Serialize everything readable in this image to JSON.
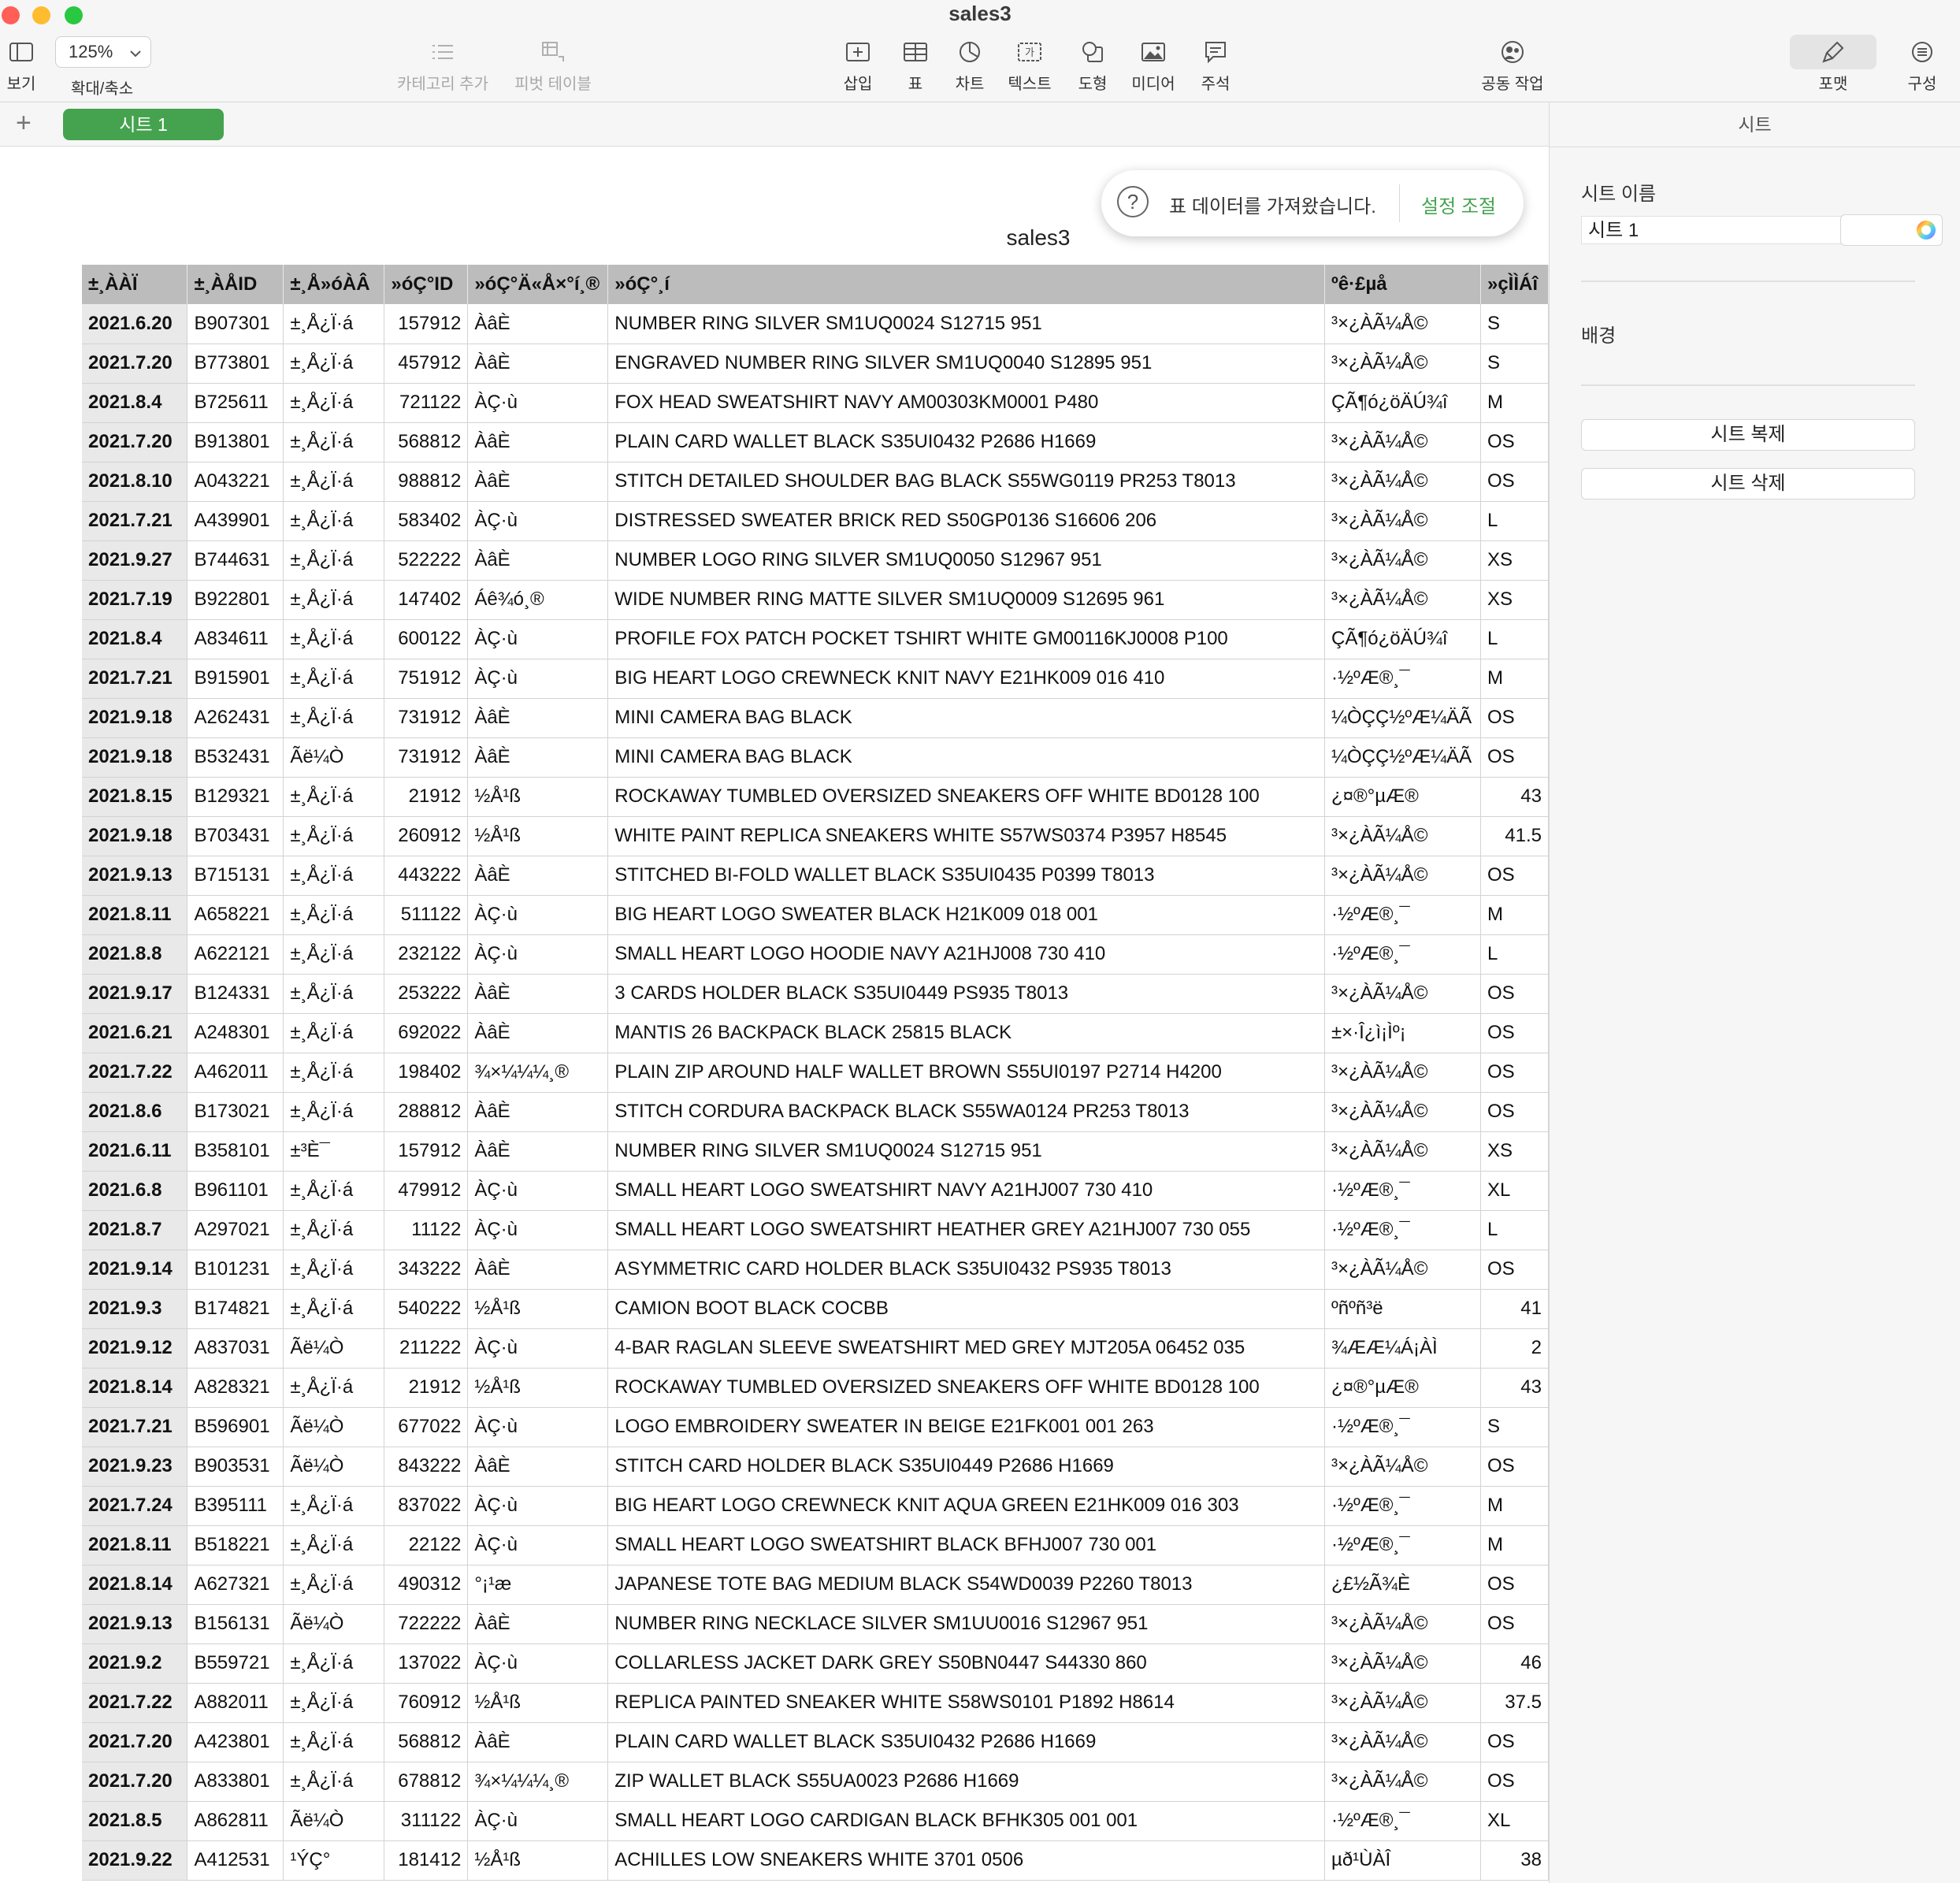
{
  "window": {
    "title": "sales3"
  },
  "toolbar": {
    "view_label": "보기",
    "zoom_value": "125%",
    "zoom_label": "확대/축소",
    "category_label": "카테고리 추가",
    "pivot_label": "피벗 테이블",
    "insert_label": "삽입",
    "table_label": "표",
    "chart_label": "차트",
    "text_label": "텍스트",
    "shape_label": "도형",
    "media_label": "미디어",
    "comment_label": "주석",
    "collab_label": "공동 작업",
    "format_label": "포맷",
    "organize_label": "구성"
  },
  "tabs": {
    "add": "+",
    "sheet_label": "시트 1"
  },
  "inspector": {
    "header": "시트",
    "sheet_name_label": "시트 이름",
    "sheet_name_value": "시트 1",
    "background_label": "배경",
    "duplicate_button": "시트 복제",
    "delete_button": "시트 삭제"
  },
  "notification": {
    "icon": "?",
    "message": "표 데이터를 가져왔습니다.",
    "action": "설정 조절"
  },
  "document": {
    "title": "sales3"
  },
  "table": {
    "headers": [
      "±¸ÀÀÏ",
      "±¸ÀÅID",
      "±¸Å»óÀÂ",
      "»óÇ°ID",
      "»óÇ°Ä«Å×°í¸®",
      "»óÇ°¸í",
      "ºê·£µå",
      "»çÌÌÁî"
    ],
    "rows": [
      [
        "2021.6.20",
        "B907301",
        "±¸Å¿Ï·á",
        "157912",
        "ÀâÈ­",
        "NUMBER RING SILVER SM1UQ0024 S12715 951",
        "³×¿ÀÃ¼Å©",
        "S"
      ],
      [
        "2021.7.20",
        "B773801",
        "±¸Å¿Ï·á",
        "457912",
        "ÀâÈ­",
        "ENGRAVED NUMBER RING SILVER SM1UQ0040 S12895 951",
        "³×¿ÀÃ¼Å©",
        "S"
      ],
      [
        "2021.8.4",
        "B725611",
        "±¸Å¿Ï·á",
        "721122",
        "ÀÇ·ù",
        "FOX HEAD SWEATSHIRT NAVY AM00303KM0001 P480",
        "ÇÃ¶ó¿öÄÚ¾î",
        "M"
      ],
      [
        "2021.7.20",
        "B913801",
        "±¸Å¿Ï·á",
        "568812",
        "ÀâÈ­",
        "PLAIN CARD WALLET BLACK S35UI0432 P2686 H1669",
        "³×¿ÀÃ¼Å©",
        "OS"
      ],
      [
        "2021.8.10",
        "A043221",
        "±¸Å¿Ï·á",
        "988812",
        "ÀâÈ­",
        "STITCH DETAILED SHOULDER BAG BLACK S55WG0119 PR253 T8013",
        "³×¿ÀÃ¼Å©",
        "OS"
      ],
      [
        "2021.7.21",
        "A439901",
        "±¸Å¿Ï·á",
        "583402",
        "ÀÇ·ù",
        "DISTRESSED SWEATER BRICK RED S50GP0136 S16606 206",
        "³×¿ÀÃ¼Å©",
        "L"
      ],
      [
        "2021.9.27",
        "B744631",
        "±¸Å¿Ï·á",
        "522222",
        "ÀâÈ­",
        "NUMBER LOGO RING SILVER SM1UQ0050 S12967 951",
        "³×¿ÀÃ¼Å©",
        "XS"
      ],
      [
        "2021.7.19",
        "B922801",
        "±¸Å¿Ï·á",
        "147402",
        "Áê¾ó¸®",
        "WIDE NUMBER RING MATTE SILVER SM1UQ0009 S12695 961",
        "³×¿ÀÃ¼Å©",
        "XS"
      ],
      [
        "2021.8.4",
        "A834611",
        "±¸Å¿Ï·á",
        "600122",
        "ÀÇ·ù",
        "PROFILE FOX PATCH POCKET TSHIRT WHITE GM00116KJ0008 P100",
        "ÇÃ¶ó¿öÄÚ¾î",
        "L"
      ],
      [
        "2021.7.21",
        "B915901",
        "±¸Å¿Ï·á",
        "751912",
        "ÀÇ·ù",
        "BIG HEART LOGO CREWNECK KNIT NAVY E21HK009 016 410",
        "·½ºÆ®¸¯",
        "M"
      ],
      [
        "2021.9.18",
        "A262431",
        "±¸Å¿Ï·á",
        "731912",
        "ÀâÈ­",
        "MINI CAMERA BAG BLACK",
        "¼ÒÇÇ½ºÆ¼ÄÃ",
        "OS"
      ],
      [
        "2021.9.18",
        "B532431",
        "Ãë¼Ò",
        "731912",
        "ÀâÈ­",
        "MINI CAMERA BAG BLACK",
        "¼ÒÇÇ½ºÆ¼ÄÃ",
        "OS"
      ],
      [
        "2021.8.15",
        "B129321",
        "±¸Å¿Ï·á",
        "21912",
        "½Å¹ß",
        "ROCKAWAY TUMBLED OVERSIZED SNEAKERS OFF WHITE BD0128 100",
        "¿¤®°µÆ®",
        "43"
      ],
      [
        "2021.9.18",
        "B703431",
        "±¸Å¿Ï·á",
        "260912",
        "½Å¹ß",
        "WHITE PAINT REPLICA SNEAKERS WHITE S57WS0374 P3957 H8545",
        "³×¿ÀÃ¼Å©",
        "41.5"
      ],
      [
        "2021.9.13",
        "B715131",
        "±¸Å¿Ï·á",
        "443222",
        "ÀâÈ­",
        "STITCHED BI-FOLD WALLET BLACK S35UI0435 P0399 T8013",
        "³×¿ÀÃ¼Å©",
        "OS"
      ],
      [
        "2021.8.11",
        "A658221",
        "±¸Å¿Ï·á",
        "511122",
        "ÀÇ·ù",
        "BIG HEART LOGO SWEATER BLACK H21K009 018 001",
        "·½ºÆ®¸¯",
        "M"
      ],
      [
        "2021.8.8",
        "A622121",
        "±¸Å¿Ï·á",
        "232122",
        "ÀÇ·ù",
        "SMALL HEART LOGO HOODIE NAVY A21HJ008 730 410",
        "·½ºÆ®¸¯",
        "L"
      ],
      [
        "2021.9.17",
        "B124331",
        "±¸Å¿Ï·á",
        "253222",
        "ÀâÈ­",
        "3 CARDS HOLDER BLACK S35UI0449 PS935 T8013",
        "³×¿ÀÃ¼Å©",
        "OS"
      ],
      [
        "2021.6.21",
        "A248301",
        "±¸Å¿Ï·á",
        "692022",
        "ÀâÈ­",
        "MANTIS 26 BACKPACK BLACK 25815 BLACK",
        "±×·Î¿ì¡Ìº¡",
        "OS"
      ],
      [
        "2021.7.22",
        "A462011",
        "±¸Å¿Ï·á",
        "198402",
        "¾×¼¼¼­¸®",
        "PLAIN ZIP AROUND HALF WALLET BROWN S55UI0197 P2714 H4200",
        "³×¿ÀÃ¼Å©",
        "OS"
      ],
      [
        "2021.8.6",
        "B173021",
        "±¸Å¿Ï·á",
        "288812",
        "ÀâÈ­",
        "STITCH CORDURA BACKPACK BLACK S55WA0124 PR253 T8013",
        "³×¿ÀÃ¼Å©",
        "OS"
      ],
      [
        "2021.6.11",
        "B358101",
        "±³È¯",
        "157912",
        "ÀâÈ­",
        "NUMBER RING SILVER SM1UQ0024 S12715 951",
        "³×¿ÀÃ¼Å©",
        "XS"
      ],
      [
        "2021.6.8",
        "B961101",
        "±¸Å¿Ï·á",
        "479912",
        "ÀÇ·ù",
        "SMALL HEART LOGO SWEATSHIRT NAVY A21HJ007 730 410",
        "·½ºÆ®¸¯",
        "XL"
      ],
      [
        "2021.8.7",
        "A297021",
        "±¸Å¿Ï·á",
        "11122",
        "ÀÇ·ù",
        "SMALL HEART LOGO SWEATSHIRT HEATHER GREY A21HJ007 730 055",
        "·½ºÆ®¸¯",
        "L"
      ],
      [
        "2021.9.14",
        "B101231",
        "±¸Å¿Ï·á",
        "343222",
        "ÀâÈ­",
        "ASYMMETRIC CARD HOLDER BLACK S35UI0432 PS935 T8013",
        "³×¿ÀÃ¼Å©",
        "OS"
      ],
      [
        "2021.9.3",
        "B174821",
        "±¸Å¿Ï·á",
        "540222",
        "½Å¹ß",
        "CAMION BOOT BLACK COCBB",
        "ºñºñ³ë",
        "41"
      ],
      [
        "2021.9.12",
        "A837031",
        "Ãë¼Ò",
        "211222",
        "ÀÇ·ù",
        "4-BAR RAGLAN SLEEVE SWEATSHIRT MED GREY MJT205A 06452 035",
        "¾ÆÆ¼Á¡ÀÌ",
        "2"
      ],
      [
        "2021.8.14",
        "A828321",
        "±¸Å¿Ï·á",
        "21912",
        "½Å¹ß",
        "ROCKAWAY TUMBLED OVERSIZED SNEAKERS OFF WHITE BD0128 100",
        "¿¤®°µÆ®",
        "43"
      ],
      [
        "2021.7.21",
        "B596901",
        "Ãë¼Ò",
        "677022",
        "ÀÇ·ù",
        "LOGO EMBROIDERY SWEATER IN BEIGE E21FK001 001 263",
        "·½ºÆ®¸¯",
        "S"
      ],
      [
        "2021.9.23",
        "B903531",
        "Ãë¼Ò",
        "843222",
        "ÀâÈ­",
        "STITCH CARD HOLDER BLACK S35UI0449 P2686 H1669",
        "³×¿ÀÃ¼Å©",
        "OS"
      ],
      [
        "2021.7.24",
        "B395111",
        "±¸Å¿Ï·á",
        "837022",
        "ÀÇ·ù",
        "BIG HEART LOGO CREWNECK KNIT AQUA GREEN E21HK009 016 303",
        "·½ºÆ®¸¯",
        "M"
      ],
      [
        "2021.8.11",
        "B518221",
        "±¸Å¿Ï·á",
        "22122",
        "ÀÇ·ù",
        "SMALL HEART LOGO SWEATSHIRT BLACK BFHJ007 730 001",
        "·½ºÆ®¸¯",
        "M"
      ],
      [
        "2021.8.14",
        "A627321",
        "±¸Å¿Ï·á",
        "490312",
        "°¡¹æ",
        "JAPANESE TOTE BAG MEDIUM BLACK S54WD0039 P2260 T8013",
        "¿£½Ã¾È",
        "OS"
      ],
      [
        "2021.9.13",
        "B156131",
        "Ãë¼Ò",
        "722222",
        "ÀâÈ­",
        "NUMBER RING NECKLACE SILVER SM1UU0016 S12967 951",
        "³×¿ÀÃ¼Å©",
        "OS"
      ],
      [
        "2021.9.2",
        "B559721",
        "±¸Å¿Ï·á",
        "137022",
        "ÀÇ·ù",
        "COLLARLESS JACKET DARK GREY S50BN0447 S44330 860",
        "³×¿ÀÃ¼Å©",
        "46"
      ],
      [
        "2021.7.22",
        "A882011",
        "±¸Å¿Ï·á",
        "760912",
        "½Å¹ß",
        "REPLICA PAINTED SNEAKER WHITE S58WS0101 P1892 H8614",
        "³×¿ÀÃ¼Å©",
        "37.5"
      ],
      [
        "2021.7.20",
        "A423801",
        "±¸Å¿Ï·á",
        "568812",
        "ÀâÈ­",
        "PLAIN CARD WALLET BLACK S35UI0432 P2686 H1669",
        "³×¿ÀÃ¼Å©",
        "OS"
      ],
      [
        "2021.7.20",
        "A833801",
        "±¸Å¿Ï·á",
        "678812",
        "¾×¼¼¼­¸®",
        "ZIP WALLET BLACK S55UA0023 P2686 H1669",
        "³×¿ÀÃ¼Å©",
        "OS"
      ],
      [
        "2021.8.5",
        "A862811",
        "Ãë¼Ò",
        "311122",
        "ÀÇ·ù",
        "SMALL HEART LOGO CARDIGAN BLACK BFHK305 001 001",
        "·½ºÆ®¸¯",
        "XL"
      ],
      [
        "2021.9.22",
        "A412531",
        "¹ÝÇ°",
        "181412",
        "½Å¹ß",
        "ACHILLES LOW SNEAKERS WHITE 3701 0506",
        "µð¹ÙÀÎ",
        "38"
      ]
    ]
  },
  "colors": {
    "accent": "#45a34f",
    "header_bg": "#bcbcbc",
    "first_col_bg": "#e9e9e9",
    "toolbar_bg": "#f6f6f6"
  },
  "icons": [
    "sidebar-icon",
    "chevron-down-icon",
    "list-icon",
    "pivot-icon",
    "insert-icon",
    "table-icon",
    "chart-icon",
    "text-icon",
    "shape-icon",
    "media-icon",
    "comment-icon",
    "collab-icon",
    "paintbrush-icon",
    "organize-icon",
    "plus-icon",
    "question-icon",
    "color-wheel-icon"
  ]
}
